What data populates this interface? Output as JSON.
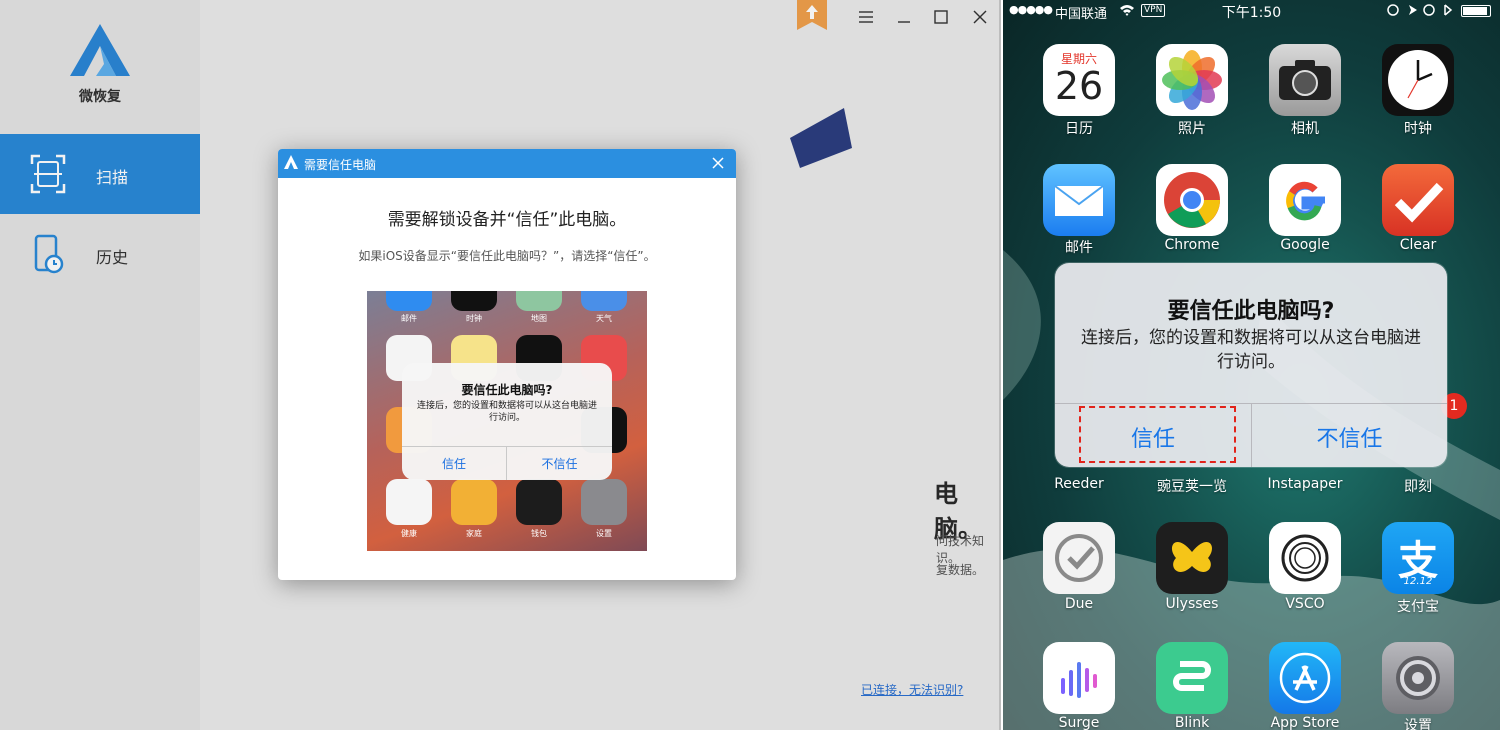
{
  "app": {
    "name": "微恢复",
    "nav": [
      {
        "label": "扫描",
        "icon": "scan-icon",
        "active": true
      },
      {
        "label": "历史",
        "icon": "history-phone-icon",
        "active": false
      }
    ],
    "background": {
      "title_fragment": "电脑。",
      "line1_fragment": "问技术知识。",
      "line2_fragment": "复数据。",
      "help_link": "已连接，无法识别?"
    },
    "accent_color": "#2a8ad8"
  },
  "dialog": {
    "title": "需要信任电脑",
    "heading": "需要解锁设备并“信任”此电脑。",
    "description": "如果iOS设备显示“要信任此电脑吗？”，请选择“信任”。",
    "screenshot": {
      "top_labels": [
        "邮件",
        "时钟",
        "地图",
        "天气"
      ],
      "bottom_labels": [
        "健康",
        "家庭",
        "钱包",
        "设置"
      ],
      "alert_title": "要信任此电脑吗?",
      "alert_message": "连接后，您的设置和数据将可以从这台电脑进行访问。",
      "trust_button": "信任",
      "distrust_button": "不信任"
    }
  },
  "phone": {
    "status": {
      "signal": "●●●●●",
      "carrier": "中国联通",
      "vpn": "VPN",
      "time": "下午1:50"
    },
    "apps": [
      {
        "label": "日历",
        "icon": "calendar-icon",
        "weekday": "星期六",
        "day": "26"
      },
      {
        "label": "照片",
        "icon": "photos-icon"
      },
      {
        "label": "相机",
        "icon": "camera-icon"
      },
      {
        "label": "时钟",
        "icon": "clock-icon"
      },
      {
        "label": "邮件",
        "icon": "mail-icon"
      },
      {
        "label": "Chrome",
        "icon": "chrome-icon"
      },
      {
        "label": "Google",
        "icon": "google-icon"
      },
      {
        "label": "Clear",
        "icon": "clear-icon"
      },
      {
        "label": "Reeder",
        "icon": "reeder-icon"
      },
      {
        "label": "豌豆荚一览",
        "icon": "wandoujia-icon"
      },
      {
        "label": "Instapaper",
        "icon": "instapaper-icon"
      },
      {
        "label": "即刻",
        "icon": "jike-icon"
      },
      {
        "label": "Due",
        "icon": "due-icon"
      },
      {
        "label": "Ulysses",
        "icon": "ulysses-icon"
      },
      {
        "label": "VSCO",
        "icon": "vsco-icon"
      },
      {
        "label": "支付宝",
        "icon": "alipay-icon",
        "icon_text": "支",
        "icon_sub": "12.12"
      },
      {
        "label": "Surge",
        "icon": "surge-icon"
      },
      {
        "label": "Blink",
        "icon": "blink-icon"
      },
      {
        "label": "App Store",
        "icon": "appstore-icon"
      },
      {
        "label": "设置",
        "icon": "settings-icon"
      }
    ],
    "badge": "1",
    "alert": {
      "title": "要信任此电脑吗?",
      "message": "连接后，您的设置和数据将可以从这台电脑进行访问。",
      "trust_button": "信任",
      "distrust_button": "不信任"
    }
  }
}
